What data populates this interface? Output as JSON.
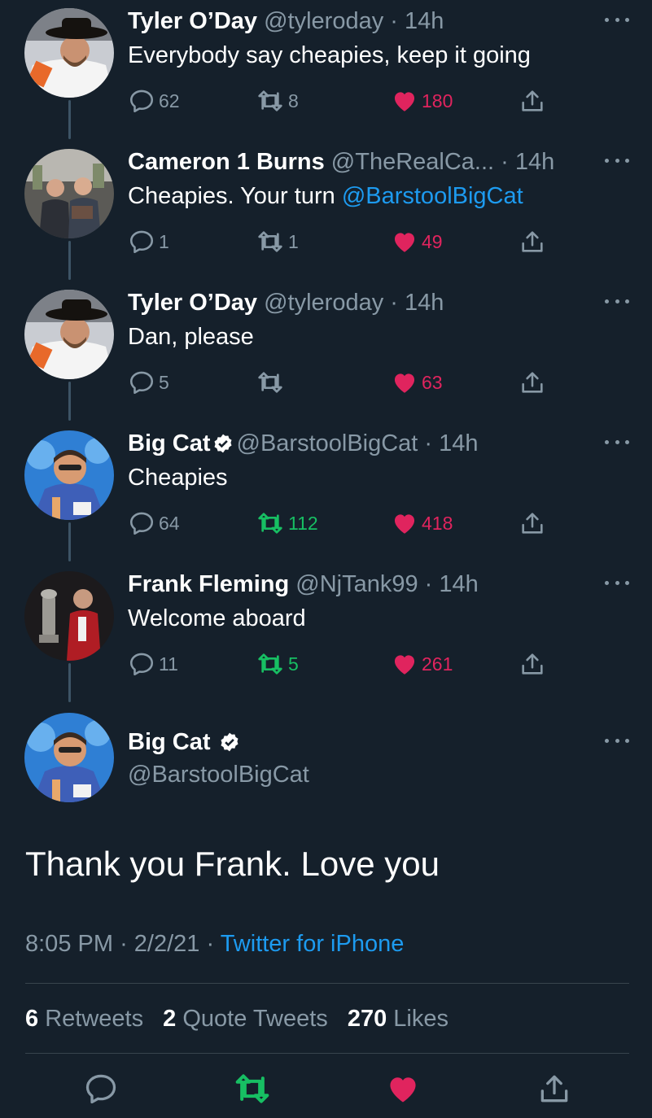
{
  "thread": [
    {
      "name": "Tyler O’Day",
      "handle": "@tyleroday",
      "time": "14h",
      "verified": false,
      "text_parts": [
        "Everybody say cheapies, keep it going"
      ],
      "mention": "",
      "replies": "62",
      "retweets": "8",
      "retweeted": false,
      "likes": "180",
      "avatar": "tyler"
    },
    {
      "name": "Cameron 1 Burns",
      "handle": "@TheRealCa...",
      "time": "14h",
      "verified": false,
      "text_parts": [
        "Cheapies. Your turn "
      ],
      "mention": "@BarstoolBigCat",
      "replies": "1",
      "retweets": "1",
      "retweeted": false,
      "likes": "49",
      "avatar": "cameron"
    },
    {
      "name": "Tyler O’Day",
      "handle": "@tyleroday",
      "time": "14h",
      "verified": false,
      "text_parts": [
        "Dan, please"
      ],
      "mention": "",
      "replies": "5",
      "retweets": "",
      "retweeted": false,
      "likes": "63",
      "avatar": "tyler"
    },
    {
      "name": "Big Cat",
      "handle": "@BarstoolBigCat",
      "time": "14h",
      "verified": true,
      "text_parts": [
        "Cheapies"
      ],
      "mention": "",
      "replies": "64",
      "retweets": "112",
      "retweeted": true,
      "likes": "418",
      "avatar": "bigcat"
    },
    {
      "name": "Frank Fleming",
      "handle": "@NjTank99",
      "time": "14h",
      "verified": false,
      "text_parts": [
        "Welcome aboard"
      ],
      "mention": "",
      "replies": "11",
      "retweets": "5",
      "retweeted": true,
      "likes": "261",
      "avatar": "frank"
    }
  ],
  "main_tweet": {
    "name": "Big Cat",
    "handle": "@BarstoolBigCat",
    "text": "Thank you Frank. Love you",
    "time": "8:05 PM",
    "date": "2/2/21",
    "source": "Twitter for iPhone",
    "retweets": "6",
    "retweets_label": "Retweets",
    "quotes": "2",
    "quotes_label": "Quote Tweets",
    "likes": "270",
    "likes_label": "Likes"
  },
  "colors": {
    "background": "#15202b",
    "secondary_text": "#8899a6",
    "link": "#1d9bf0",
    "like": "#e0245e",
    "retweet_active": "#17bf63",
    "divider": "#38444d"
  },
  "icons": {
    "reply": "reply-icon",
    "retweet": "retweet-icon",
    "like": "heart-icon",
    "share": "share-icon",
    "more": "more-icon",
    "verified": "verified-badge-icon"
  }
}
